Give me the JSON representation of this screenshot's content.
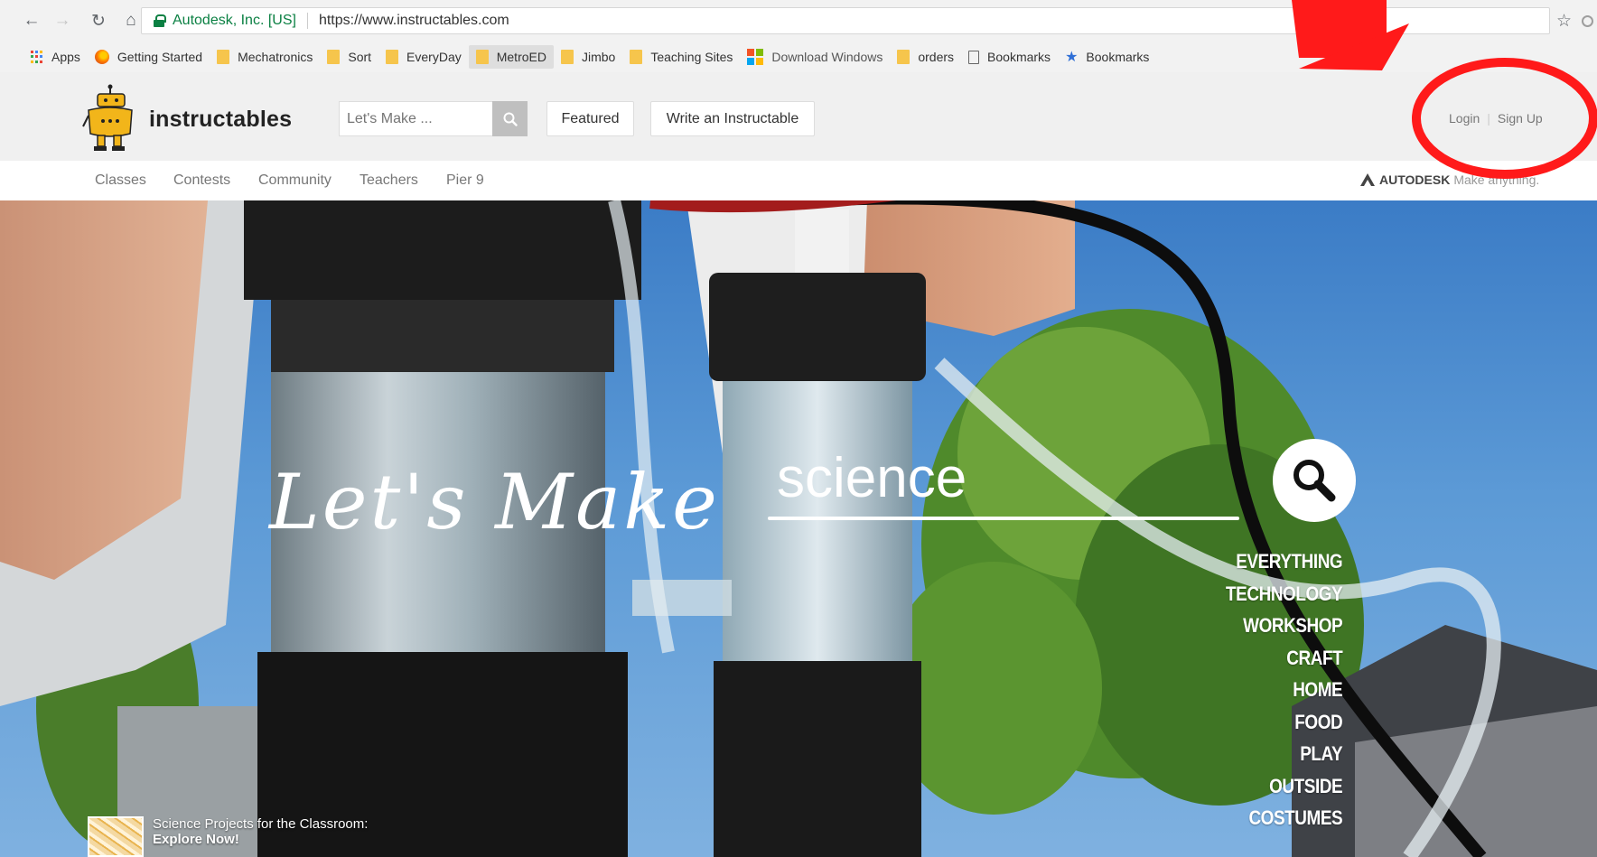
{
  "browser": {
    "site_identity": "Autodesk, Inc. [US]",
    "url": "https://www.instructables.com",
    "bookmarks": [
      {
        "label": "Apps",
        "icon": "apps-grid-icon"
      },
      {
        "label": "Getting Started",
        "icon": "firefox-icon"
      },
      {
        "label": "Mechatronics",
        "icon": "folder-icon"
      },
      {
        "label": "Sort",
        "icon": "folder-icon"
      },
      {
        "label": "EveryDay",
        "icon": "folder-icon"
      },
      {
        "label": "MetroED",
        "icon": "folder-icon"
      },
      {
        "label": "Jimbo",
        "icon": "folder-icon"
      },
      {
        "label": "Teaching Sites",
        "icon": "folder-icon"
      },
      {
        "label": "Download Windows",
        "icon": "windows-icon"
      },
      {
        "label": "orders",
        "icon": "folder-icon"
      },
      {
        "label": "Bookmarks",
        "icon": "page-icon"
      },
      {
        "label": "Bookmarks",
        "icon": "star-icon"
      }
    ]
  },
  "header": {
    "logo_text": "instructables",
    "search_placeholder": "Let's Make ...",
    "featured_label": "Featured",
    "write_label": "Write an Instructable",
    "login_label": "Login",
    "signup_label": "Sign Up"
  },
  "nav": {
    "items": [
      "Classes",
      "Contests",
      "Community",
      "Teachers",
      "Pier 9"
    ],
    "autodesk": "AUTODESK",
    "autodesk_tagline": "Make anything."
  },
  "hero": {
    "title": "Let's Make",
    "query": "science",
    "categories": [
      "EVERYTHING",
      "TECHNOLOGY",
      "WORKSHOP",
      "CRAFT",
      "HOME",
      "FOOD",
      "PLAY",
      "OUTSIDE",
      "COSTUMES"
    ],
    "promo_line1": "Science Projects for the Classroom:",
    "promo_line2": "Explore Now!"
  },
  "colors": {
    "annotation_red": "#ff1a1a",
    "site_identity_green": "#0b8043",
    "folder_yellow": "#f6c54c"
  }
}
